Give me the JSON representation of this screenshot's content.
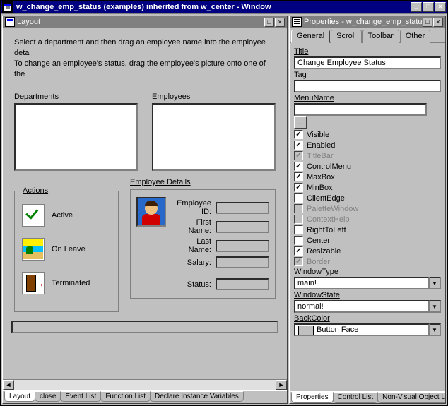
{
  "window": {
    "title": "w_change_emp_status (examples) inherited from w_center - Window",
    "sys_buttons": {
      "min": "_",
      "max": "□",
      "close": "×"
    }
  },
  "layout_panel": {
    "title": "Layout",
    "instructions_line1": "Select a department and then drag an employee name into the employee deta",
    "instructions_line2": "To change an employee's status, drag the employee's picture onto one of the",
    "departments_label": "Departments",
    "employees_label": "Employees",
    "actions_label": "Actions",
    "actions": [
      {
        "id": "active",
        "label": "Active"
      },
      {
        "id": "onleave",
        "label": "On Leave"
      },
      {
        "id": "terminated",
        "label": "Terminated"
      }
    ],
    "employee_details_label": "Employee Details",
    "fields": {
      "emp_id": "Employee ID:",
      "first_name": "First Name:",
      "last_name": "Last Name:",
      "salary": "Salary:",
      "status": "Status:"
    },
    "bottom_tabs": [
      "Layout",
      "close",
      "Event List",
      "Function List",
      "Declare Instance Variables"
    ],
    "active_bottom_tab": 0
  },
  "props_panel": {
    "title": "Properties - w_change_emp_status inh",
    "tabs": [
      "General",
      "Scroll",
      "Toolbar",
      "Other"
    ],
    "active_tab": 0,
    "title_label": "Title",
    "title_value": "Change Employee Status",
    "tag_label": "Tag",
    "tag_value": "",
    "menuname_label": "MenuName",
    "menuname_value": "",
    "browse_btn": "...",
    "checks": [
      {
        "id": "visible",
        "label": "Visible",
        "checked": true,
        "enabled": true
      },
      {
        "id": "enabled",
        "label": "Enabled",
        "checked": true,
        "enabled": true
      },
      {
        "id": "titlebar",
        "label": "TitleBar",
        "checked": true,
        "enabled": false
      },
      {
        "id": "controlmenu",
        "label": "ControlMenu",
        "checked": true,
        "enabled": true
      },
      {
        "id": "maxbox",
        "label": "MaxBox",
        "checked": true,
        "enabled": true
      },
      {
        "id": "minbox",
        "label": "MinBox",
        "checked": true,
        "enabled": true
      },
      {
        "id": "clientedge",
        "label": "ClientEdge",
        "checked": false,
        "enabled": true
      },
      {
        "id": "palettewindow",
        "label": "PaletteWindow",
        "checked": false,
        "enabled": false
      },
      {
        "id": "contexthelp",
        "label": "ContextHelp",
        "checked": false,
        "enabled": false
      },
      {
        "id": "righttoleft",
        "label": "RightToLeft",
        "checked": false,
        "enabled": true
      },
      {
        "id": "center",
        "label": "Center",
        "checked": false,
        "enabled": true
      },
      {
        "id": "resizable",
        "label": "Resizable",
        "checked": true,
        "enabled": true
      },
      {
        "id": "border",
        "label": "Border",
        "checked": true,
        "enabled": false
      }
    ],
    "windowtype_label": "WindowType",
    "windowtype_value": "main!",
    "windowstate_label": "WindowState",
    "windowstate_value": "normal!",
    "backcolor_label": "BackColor",
    "backcolor_value": "Button Face",
    "bottom_tabs": [
      "Properties",
      "Control List",
      "Non-Visual Object List"
    ],
    "active_bottom_tab": 0
  }
}
